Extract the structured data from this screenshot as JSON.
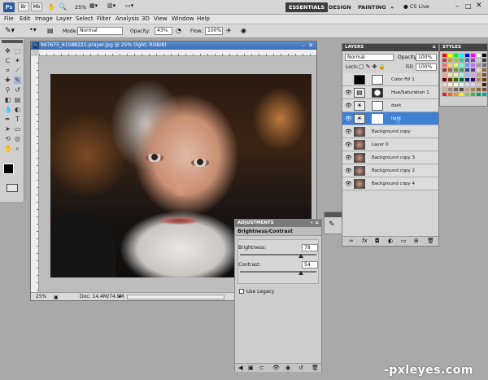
{
  "appbar": {
    "logo": "Ps",
    "zoom": "25%",
    "workspaces": [
      "ESSENTIALS",
      "DESIGN",
      "PAINTING"
    ],
    "more": "»",
    "cs_live": "CS Live"
  },
  "menu": [
    "File",
    "Edit",
    "Image",
    "Layer",
    "Select",
    "Filter",
    "Analysis",
    "3D",
    "View",
    "Window",
    "Help"
  ],
  "options": {
    "mode_label": "Mode:",
    "mode_value": "Normal",
    "opacity_label": "Opacity:",
    "opacity_value": "43%",
    "flow_label": "Flow:",
    "flow_value": "100%"
  },
  "document": {
    "title": "967675_61588221-prayer.jpg @ 25% (light, RGB/8)",
    "zoom": "25%",
    "doc_info": "Doc: 14.4M/74.9M"
  },
  "adjustments": {
    "panel_title": "ADJUSTMENTS",
    "title": "Brightness/Contrast",
    "brightness_label": "Brightness:",
    "brightness_value": "78",
    "contrast_label": "Contrast:",
    "contrast_value": "54",
    "legacy_label": "Use Legacy"
  },
  "layers": {
    "panel_title": "LAYERS",
    "blend_mode": "Normal",
    "opacity_label": "Opacity:",
    "opacity_value": "100%",
    "lock_label": "Lock:",
    "fill_label": "Fill:",
    "fill_value": "100%",
    "items": [
      {
        "name": "Color Fill 1"
      },
      {
        "name": "Hue/Saturation 1"
      },
      {
        "name": "dark"
      },
      {
        "name": "light"
      },
      {
        "name": "Background copy"
      },
      {
        "name": "Layer 0"
      },
      {
        "name": "Background copy 3"
      },
      {
        "name": "Background copy 2"
      },
      {
        "name": "Background copy 4"
      }
    ]
  },
  "swatches": {
    "panel_title": "STYLES",
    "colors": [
      "#ff0000",
      "#ffff00",
      "#00ff00",
      "#00ffff",
      "#0000ff",
      "#ff00ff",
      "#ffffff",
      "#000000",
      "#cc3333",
      "#cc9933",
      "#99cc33",
      "#33cc99",
      "#3366cc",
      "#9933cc",
      "#cccccc",
      "#333333",
      "#ff6666",
      "#ffcc66",
      "#ccff66",
      "#66ffcc",
      "#6699ff",
      "#cc66ff",
      "#999999",
      "#666666",
      "#993333",
      "#996633",
      "#669933",
      "#339966",
      "#334499",
      "#663399",
      "#f2d5b5",
      "#8c6239",
      "#ff9999",
      "#ffe699",
      "#e6ff99",
      "#99ffe6",
      "#99bbff",
      "#e699ff",
      "#c69c6d",
      "#754c24",
      "#660000",
      "#663300",
      "#336600",
      "#006633",
      "#002266",
      "#330066",
      "#a67c52",
      "#603913",
      "#ffcccc",
      "#fff2cc",
      "#f2ffcc",
      "#ccfff2",
      "#ccddff",
      "#f2ccff",
      "#e8c39e",
      "#42210b",
      "#c7b299",
      "#998675",
      "#736357",
      "#534741",
      "#c69c6d",
      "#a67c52",
      "#8c6239",
      "#754c24",
      "#ed1c24",
      "#f26522",
      "#f7941d",
      "#fff200",
      "#8dc63f",
      "#39b54a",
      "#00a651",
      "#00a99d"
    ]
  },
  "watermark": "-pxleyes.com"
}
